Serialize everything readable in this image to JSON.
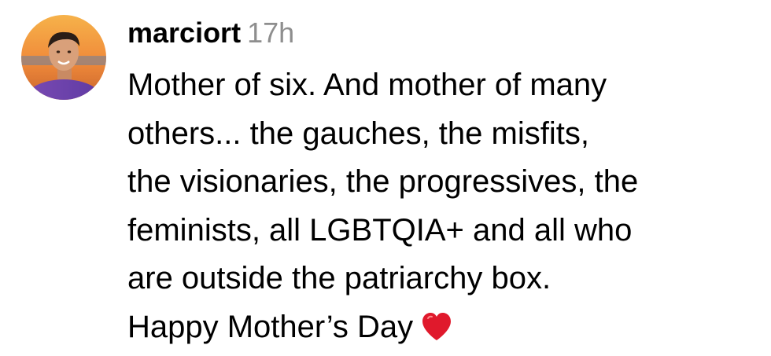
{
  "comment": {
    "avatar": "avatar-photo",
    "username": "marciort",
    "timestamp": "17h",
    "lines": [
      "Mother of six. And mother of many",
      "others... the gauches, the misfits,",
      "the visionaries, the progressives, the",
      "feminists, all LGBTQIA+ and all who",
      "are outside the patriarchy box.",
      "Happy Mother’s Day"
    ],
    "emoji": "heart-icon"
  },
  "colors": {
    "text": "#000000",
    "timestamp": "#8e8e8e",
    "heart": "#e0192c"
  }
}
